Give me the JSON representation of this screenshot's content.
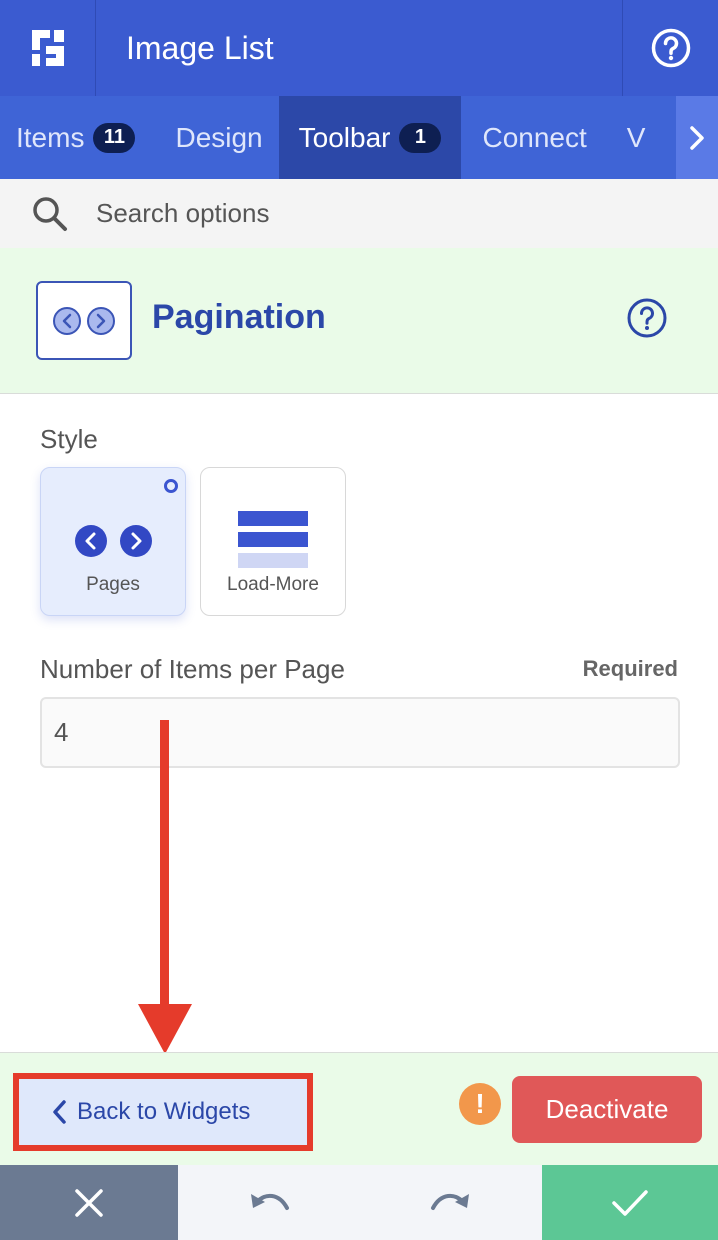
{
  "header": {
    "title": "Image List",
    "logo_icon": "logo-icon",
    "help_icon": "help-icon"
  },
  "tabs": [
    {
      "label": "Items",
      "badge": "11",
      "active": false
    },
    {
      "label": "Design",
      "badge": null,
      "active": false
    },
    {
      "label": "Toolbar",
      "badge": "1",
      "active": true
    },
    {
      "label": "Connect",
      "badge": null,
      "active": false
    },
    {
      "label": "V",
      "badge": null,
      "active": false
    }
  ],
  "search": {
    "placeholder": "Search options",
    "value": ""
  },
  "widget": {
    "title": "Pagination",
    "icon": "pagination-icon"
  },
  "style_section": {
    "label": "Style",
    "options": [
      {
        "label": "Pages",
        "selected": true,
        "icon": "pages-icon"
      },
      {
        "label": "Load-More",
        "selected": false,
        "icon": "load-more-icon"
      }
    ]
  },
  "items_per_page": {
    "label": "Number of Items per Page",
    "required_label": "Required",
    "value": "4"
  },
  "actions": {
    "back_label": "Back to Widgets",
    "deactivate_label": "Deactivate",
    "warning_glyph": "!"
  },
  "footer": {
    "close_icon": "close-icon",
    "undo_icon": "undo-icon",
    "redo_icon": "redo-icon",
    "confirm_icon": "check-icon"
  },
  "colors": {
    "header": "#3b5bd0",
    "tabs": "#3f64d6",
    "tab_active": "#2c48a8",
    "widget_bg": "#eafbe8",
    "accent_text": "#2b47a8",
    "deactivate": "#e05858",
    "warning": "#f2974b",
    "annotation": "#e53b2b",
    "confirm": "#5cc795",
    "cancel": "#6b7a92"
  }
}
